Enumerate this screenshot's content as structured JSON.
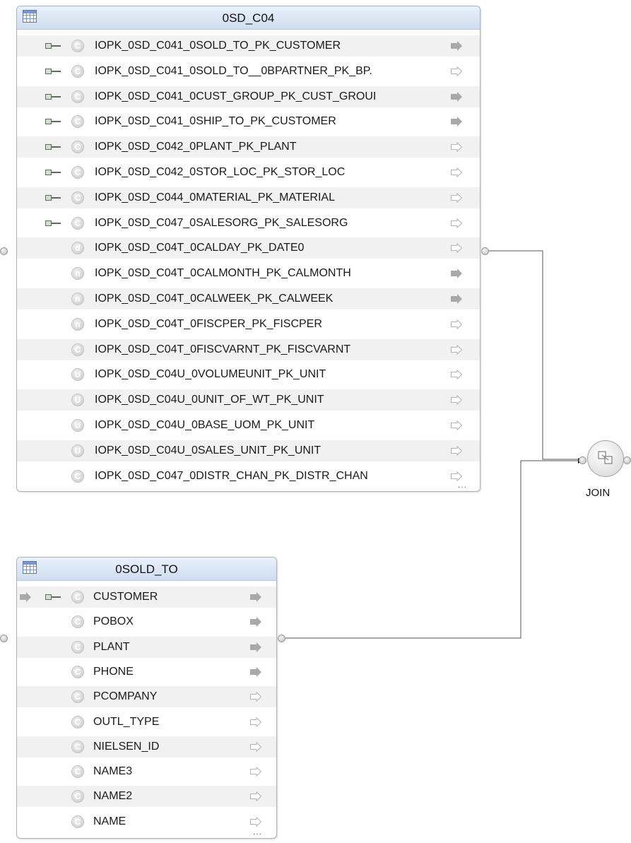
{
  "tables": {
    "sd_c04": {
      "title": "0SD_C04",
      "columns": [
        {
          "name": "IOPK_0SD_C041_0SOLD_TO_PK_CUSTOMER",
          "key": true,
          "type": "C",
          "arrow": "filled"
        },
        {
          "name": "IOPK_0SD_C041_0SOLD_TO__0BPARTNER_PK_BP.",
          "key": true,
          "type": "C",
          "arrow": "outline"
        },
        {
          "name": "IOPK_0SD_C041_0CUST_GROUP_PK_CUST_GROUI",
          "key": true,
          "type": "C",
          "arrow": "filled"
        },
        {
          "name": "IOPK_0SD_C041_0SHIP_TO_PK_CUSTOMER",
          "key": true,
          "type": "C",
          "arrow": "filled"
        },
        {
          "name": "IOPK_0SD_C042_0PLANT_PK_PLANT",
          "key": true,
          "type": "C",
          "arrow": "outline"
        },
        {
          "name": "IOPK_0SD_C042_0STOR_LOC_PK_STOR_LOC",
          "key": true,
          "type": "C",
          "arrow": "outline"
        },
        {
          "name": "IOPK_0SD_C044_0MATERIAL_PK_MATERIAL",
          "key": true,
          "type": "C",
          "arrow": "outline"
        },
        {
          "name": "IOPK_0SD_C047_0SALESORG_PK_SALESORG",
          "key": true,
          "type": "C",
          "arrow": "outline"
        },
        {
          "name": "IOPK_0SD_C04T_0CALDAY_PK_DATE0",
          "key": false,
          "type": "d",
          "arrow": "outline"
        },
        {
          "name": "IOPK_0SD_C04T_0CALMONTH_PK_CALMONTH",
          "key": false,
          "type": "n",
          "arrow": "filled"
        },
        {
          "name": "IOPK_0SD_C04T_0CALWEEK_PK_CALWEEK",
          "key": false,
          "type": "n",
          "arrow": "filled"
        },
        {
          "name": "IOPK_0SD_C04T_0FISCPER_PK_FISCPER",
          "key": false,
          "type": "n",
          "arrow": "outline"
        },
        {
          "name": "IOPK_0SD_C04T_0FISCVARNT_PK_FISCVARNT",
          "key": false,
          "type": "C",
          "arrow": "outline"
        },
        {
          "name": "IOPK_0SD_C04U_0VOLUMEUNIT_PK_UNIT",
          "key": false,
          "type": "U",
          "arrow": "outline"
        },
        {
          "name": "IOPK_0SD_C04U_0UNIT_OF_WT_PK_UNIT",
          "key": false,
          "type": "U",
          "arrow": "outline"
        },
        {
          "name": "IOPK_0SD_C04U_0BASE_UOM_PK_UNIT",
          "key": false,
          "type": "U",
          "arrow": "outline"
        },
        {
          "name": "IOPK_0SD_C04U_0SALES_UNIT_PK_UNIT",
          "key": false,
          "type": "U",
          "arrow": "outline"
        },
        {
          "name": "IOPK_0SD_C047_0DISTR_CHAN_PK_DISTR_CHAN",
          "key": false,
          "type": "C",
          "arrow": "outline"
        }
      ],
      "more_indicator": "..."
    },
    "sold_to": {
      "title": "0SOLD_TO",
      "columns": [
        {
          "name": "CUSTOMER",
          "key": true,
          "type": "C",
          "arrow": "filled",
          "in_arrow": true
        },
        {
          "name": "POBOX",
          "key": false,
          "type": "C",
          "arrow": "filled"
        },
        {
          "name": "PLANT",
          "key": false,
          "type": "C",
          "arrow": "filled"
        },
        {
          "name": "PHONE",
          "key": false,
          "type": "C",
          "arrow": "filled"
        },
        {
          "name": "PCOMPANY",
          "key": false,
          "type": "C",
          "arrow": "outline"
        },
        {
          "name": "OUTL_TYPE",
          "key": false,
          "type": "C",
          "arrow": "outline"
        },
        {
          "name": "NIELSEN_ID",
          "key": false,
          "type": "C",
          "arrow": "outline"
        },
        {
          "name": "NAME3",
          "key": false,
          "type": "C",
          "arrow": "outline"
        },
        {
          "name": "NAME2",
          "key": false,
          "type": "C",
          "arrow": "outline"
        },
        {
          "name": "NAME",
          "key": false,
          "type": "C",
          "arrow": "outline"
        }
      ],
      "more_indicator": "..."
    }
  },
  "join_node": {
    "label": "JOIN"
  },
  "colors": {
    "header_top": "#e9f1fb",
    "header_bottom": "#cfddef",
    "border": "#a9b3c4",
    "row_alt": "#f1f1f1",
    "wire": "#555555",
    "arrow_filled": "#a9a9a9"
  }
}
